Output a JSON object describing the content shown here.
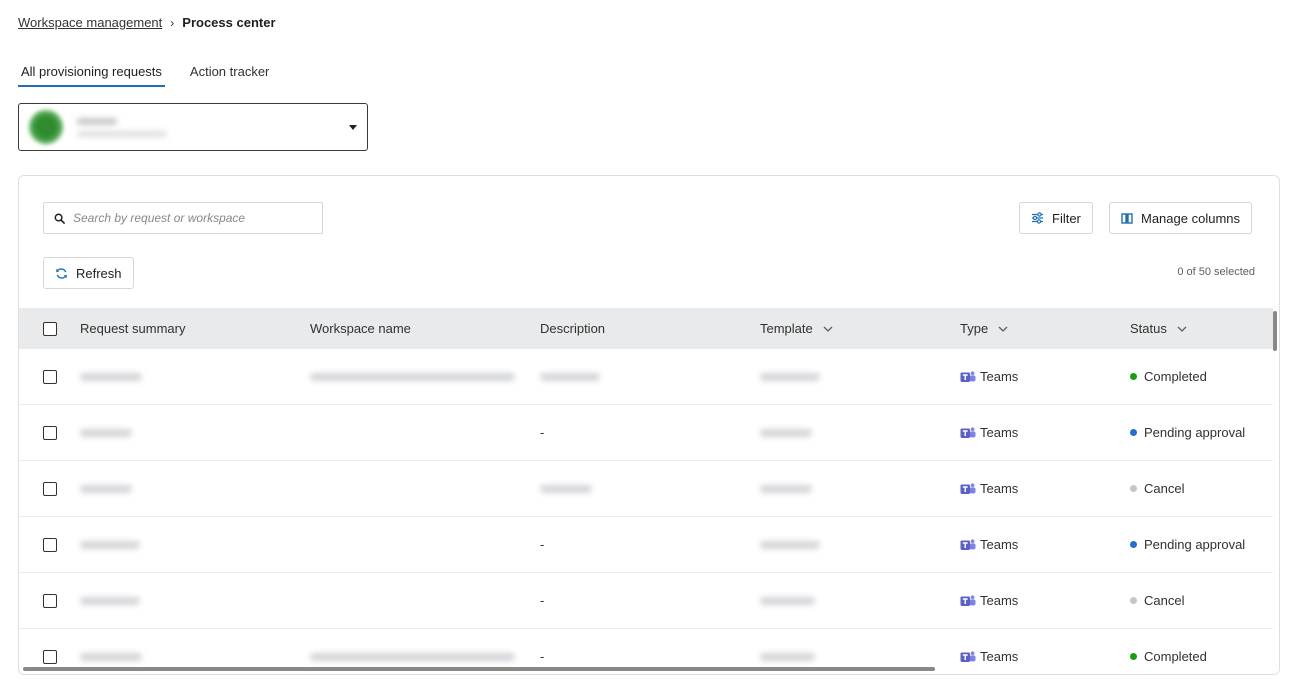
{
  "breadcrumb": {
    "parent": "Workspace management",
    "current": "Process center"
  },
  "tabs": [
    {
      "label": "All provisioning requests",
      "active": true
    },
    {
      "label": "Action tracker",
      "active": false
    }
  ],
  "search": {
    "placeholder": "Search by request or workspace"
  },
  "toolbar": {
    "filter_label": "Filter",
    "manage_columns_label": "Manage columns",
    "refresh_label": "Refresh",
    "selected_text": "0 of 50 selected"
  },
  "table": {
    "columns": [
      "Request summary",
      "Workspace name",
      "Description",
      "Template",
      "Type",
      "Status"
    ],
    "rows": [
      {
        "description": "",
        "type": "Teams",
        "status": "Completed",
        "status_color": "#13a10e"
      },
      {
        "description": "-",
        "type": "Teams",
        "status": "Pending approval",
        "status_color": "#1f6fd0"
      },
      {
        "description": "",
        "type": "Teams",
        "status": "Cancel",
        "status_color": "#c8c6c4"
      },
      {
        "description": "-",
        "type": "Teams",
        "status": "Pending approval",
        "status_color": "#1f6fd0"
      },
      {
        "description": "-",
        "type": "Teams",
        "status": "Cancel",
        "status_color": "#c8c6c4"
      },
      {
        "description": "-",
        "type": "Teams",
        "status": "Completed",
        "status_color": "#13a10e"
      }
    ]
  },
  "colors": {
    "accent": "#1f6fb5",
    "teams_purple": "#5b5fc7"
  },
  "icons": {
    "search": "search-icon",
    "filter": "sliders-icon",
    "columns": "columns-icon",
    "refresh": "refresh-icon",
    "type": "teams-icon"
  }
}
